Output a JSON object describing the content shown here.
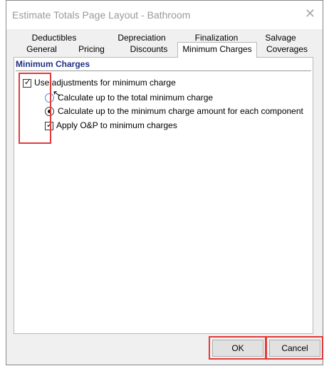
{
  "window": {
    "title": "Estimate Totals Page Layout - Bathroom",
    "close_glyph": "✕"
  },
  "tabs_back": [
    {
      "label": "Deductibles"
    },
    {
      "label": "Depreciation"
    },
    {
      "label": "Finalization"
    },
    {
      "label": "Salvage"
    }
  ],
  "tabs_front": [
    {
      "label": "General"
    },
    {
      "label": "Pricing"
    },
    {
      "label": "Discounts"
    },
    {
      "label": "Minimum Charges",
      "active": true
    },
    {
      "label": "Coverages"
    }
  ],
  "section": {
    "title": "Minimum Charges"
  },
  "options": {
    "use_adjustments": {
      "label": "Use adjustments for minimum charge",
      "checked": true
    },
    "radio_total": {
      "label": "Calculate up to the total minimum charge",
      "selected": false
    },
    "radio_component": {
      "label": "Calculate up to the minimum charge amount for each component",
      "selected": true
    },
    "apply_op": {
      "label": "Apply O&P to minimum charges",
      "checked": true
    }
  },
  "buttons": {
    "ok": "OK",
    "cancel": "Cancel"
  },
  "colors": {
    "accent": "#1f2f86",
    "highlight": "#e23b3b"
  }
}
